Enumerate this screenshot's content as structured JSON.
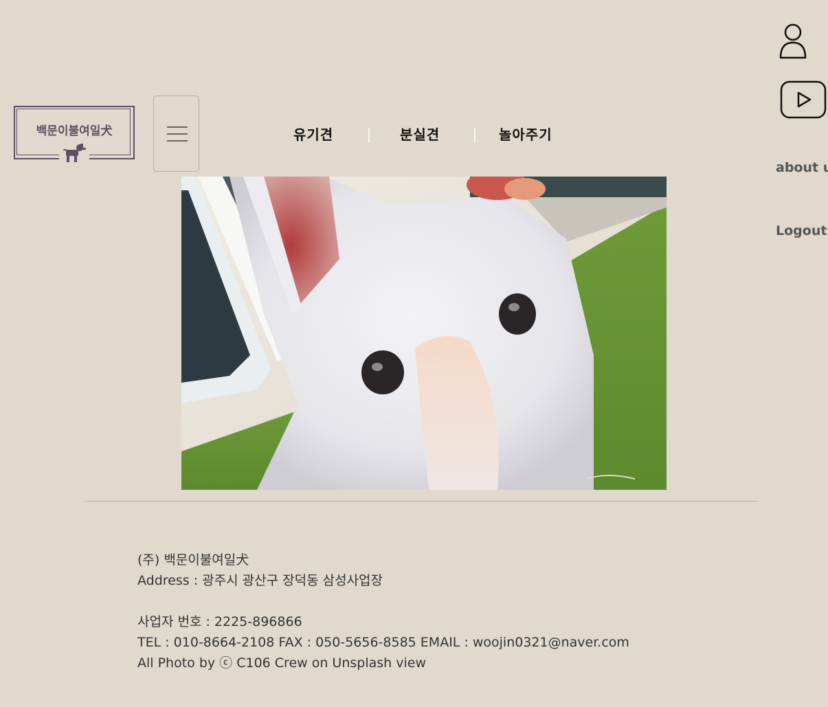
{
  "header": {
    "logo_text": "백문이불여일犬",
    "menu_button_icon": "hamburger-icon",
    "nav": [
      {
        "label": "유기견"
      },
      {
        "label": "분실견"
      },
      {
        "label": "놀아주기"
      }
    ]
  },
  "side": {
    "user_icon": "user-icon",
    "youtube_icon": "youtube-play-icon",
    "about_label": "about us",
    "logout_label": "Logout"
  },
  "hero": {
    "subject": "white puppy photo"
  },
  "footer": {
    "company": "(주) 백문이불여일犬",
    "address": "Address : 광주시 광산구 장덕동 삼성사업장",
    "business_no": "사업자 번호 : 2225-896866",
    "contact": "TEL : 010-8664-2108 FAX : 050-5656-8585 EMAIL : woojin0321@naver.com",
    "credit": "All Photo by ⓒ C106 Crew on Unsplash view"
  },
  "colors": {
    "background": "#e1d9ce",
    "logo": "#5e4f64",
    "nav_text": "#111111",
    "side_text": "#555555"
  }
}
